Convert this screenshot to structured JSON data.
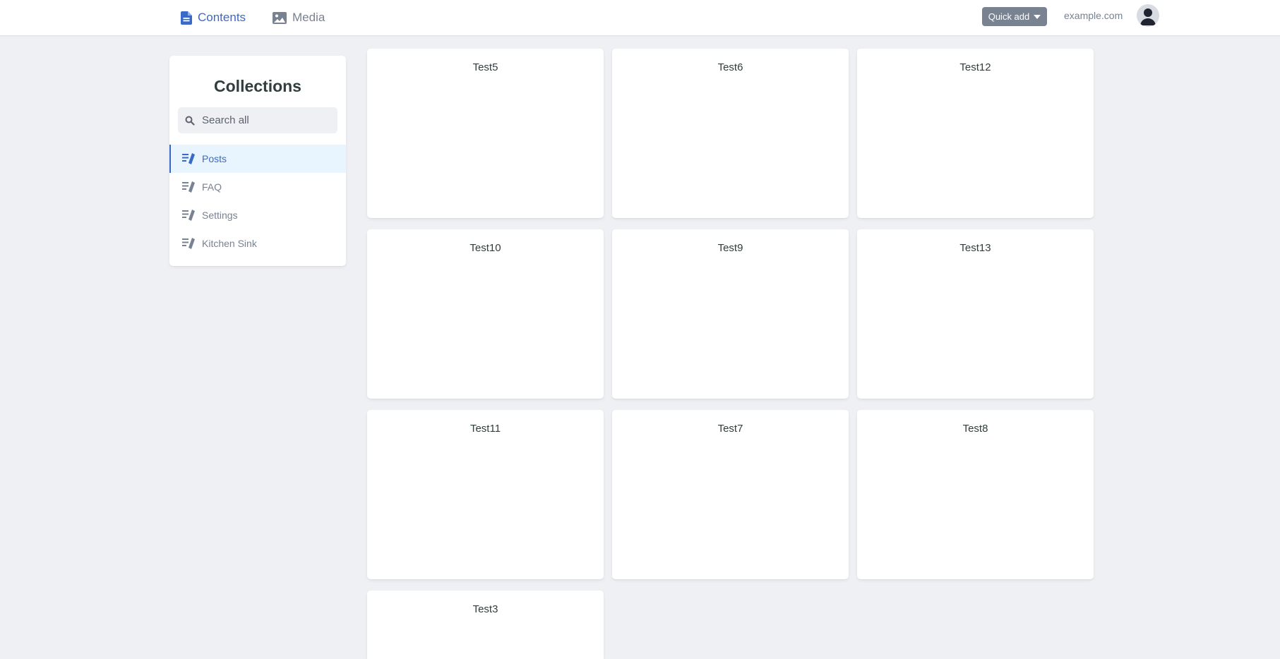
{
  "header": {
    "nav": [
      {
        "label": "Contents",
        "icon": "document-icon",
        "active": true
      },
      {
        "label": "Media",
        "icon": "image-icon",
        "active": false
      }
    ],
    "quick_add_label": "Quick add",
    "site_link": "example.com",
    "avatar_icon": "user-avatar-icon"
  },
  "sidebar": {
    "title": "Collections",
    "search_placeholder": "Search all",
    "items": [
      {
        "label": "Posts",
        "icon": "collection-icon",
        "active": true
      },
      {
        "label": "FAQ",
        "icon": "collection-icon",
        "active": false
      },
      {
        "label": "Settings",
        "icon": "collection-icon",
        "active": false
      },
      {
        "label": "Kitchen Sink",
        "icon": "collection-icon",
        "active": false
      }
    ]
  },
  "entries": [
    {
      "title": "Test5"
    },
    {
      "title": "Test6"
    },
    {
      "title": "Test12"
    },
    {
      "title": "Test10"
    },
    {
      "title": "Test9"
    },
    {
      "title": "Test13"
    },
    {
      "title": "Test11"
    },
    {
      "title": "Test7"
    },
    {
      "title": "Test8"
    },
    {
      "title": "Test3"
    }
  ],
  "colors": {
    "accent": "#3a69c7",
    "background": "#eff0f4",
    "muted_text": "#798291",
    "active_row_bg": "#e8f5fe"
  }
}
